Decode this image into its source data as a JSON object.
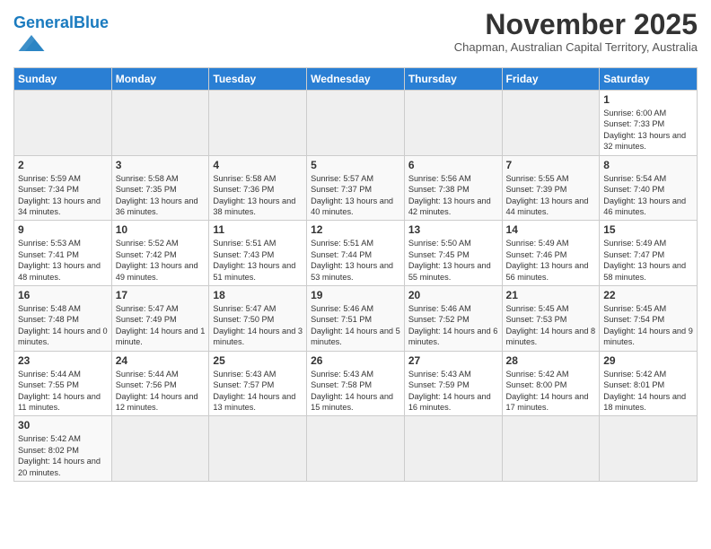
{
  "header": {
    "logo_general": "General",
    "logo_blue": "Blue",
    "month_title": "November 2025",
    "subtitle": "Chapman, Australian Capital Territory, Australia"
  },
  "days_of_week": [
    "Sunday",
    "Monday",
    "Tuesday",
    "Wednesday",
    "Thursday",
    "Friday",
    "Saturday"
  ],
  "weeks": [
    {
      "days": [
        {
          "date": "",
          "empty": true
        },
        {
          "date": "",
          "empty": true
        },
        {
          "date": "",
          "empty": true
        },
        {
          "date": "",
          "empty": true
        },
        {
          "date": "",
          "empty": true
        },
        {
          "date": "",
          "empty": true
        },
        {
          "date": "1",
          "sunrise": "6:00 AM",
          "sunset": "7:33 PM",
          "daylight": "13 hours and 32 minutes."
        }
      ]
    },
    {
      "days": [
        {
          "date": "2",
          "sunrise": "5:59 AM",
          "sunset": "7:34 PM",
          "daylight": "13 hours and 34 minutes."
        },
        {
          "date": "3",
          "sunrise": "5:58 AM",
          "sunset": "7:35 PM",
          "daylight": "13 hours and 36 minutes."
        },
        {
          "date": "4",
          "sunrise": "5:58 AM",
          "sunset": "7:36 PM",
          "daylight": "13 hours and 38 minutes."
        },
        {
          "date": "5",
          "sunrise": "5:57 AM",
          "sunset": "7:37 PM",
          "daylight": "13 hours and 40 minutes."
        },
        {
          "date": "6",
          "sunrise": "5:56 AM",
          "sunset": "7:38 PM",
          "daylight": "13 hours and 42 minutes."
        },
        {
          "date": "7",
          "sunrise": "5:55 AM",
          "sunset": "7:39 PM",
          "daylight": "13 hours and 44 minutes."
        },
        {
          "date": "8",
          "sunrise": "5:54 AM",
          "sunset": "7:40 PM",
          "daylight": "13 hours and 46 minutes."
        }
      ]
    },
    {
      "days": [
        {
          "date": "9",
          "sunrise": "5:53 AM",
          "sunset": "7:41 PM",
          "daylight": "13 hours and 48 minutes."
        },
        {
          "date": "10",
          "sunrise": "5:52 AM",
          "sunset": "7:42 PM",
          "daylight": "13 hours and 49 minutes."
        },
        {
          "date": "11",
          "sunrise": "5:51 AM",
          "sunset": "7:43 PM",
          "daylight": "13 hours and 51 minutes."
        },
        {
          "date": "12",
          "sunrise": "5:51 AM",
          "sunset": "7:44 PM",
          "daylight": "13 hours and 53 minutes."
        },
        {
          "date": "13",
          "sunrise": "5:50 AM",
          "sunset": "7:45 PM",
          "daylight": "13 hours and 55 minutes."
        },
        {
          "date": "14",
          "sunrise": "5:49 AM",
          "sunset": "7:46 PM",
          "daylight": "13 hours and 56 minutes."
        },
        {
          "date": "15",
          "sunrise": "5:49 AM",
          "sunset": "7:47 PM",
          "daylight": "13 hours and 58 minutes."
        }
      ]
    },
    {
      "days": [
        {
          "date": "16",
          "sunrise": "5:48 AM",
          "sunset": "7:48 PM",
          "daylight": "14 hours and 0 minutes."
        },
        {
          "date": "17",
          "sunrise": "5:47 AM",
          "sunset": "7:49 PM",
          "daylight": "14 hours and 1 minute."
        },
        {
          "date": "18",
          "sunrise": "5:47 AM",
          "sunset": "7:50 PM",
          "daylight": "14 hours and 3 minutes."
        },
        {
          "date": "19",
          "sunrise": "5:46 AM",
          "sunset": "7:51 PM",
          "daylight": "14 hours and 5 minutes."
        },
        {
          "date": "20",
          "sunrise": "5:46 AM",
          "sunset": "7:52 PM",
          "daylight": "14 hours and 6 minutes."
        },
        {
          "date": "21",
          "sunrise": "5:45 AM",
          "sunset": "7:53 PM",
          "daylight": "14 hours and 8 minutes."
        },
        {
          "date": "22",
          "sunrise": "5:45 AM",
          "sunset": "7:54 PM",
          "daylight": "14 hours and 9 minutes."
        }
      ]
    },
    {
      "days": [
        {
          "date": "23",
          "sunrise": "5:44 AM",
          "sunset": "7:55 PM",
          "daylight": "14 hours and 11 minutes."
        },
        {
          "date": "24",
          "sunrise": "5:44 AM",
          "sunset": "7:56 PM",
          "daylight": "14 hours and 12 minutes."
        },
        {
          "date": "25",
          "sunrise": "5:43 AM",
          "sunset": "7:57 PM",
          "daylight": "14 hours and 13 minutes."
        },
        {
          "date": "26",
          "sunrise": "5:43 AM",
          "sunset": "7:58 PM",
          "daylight": "14 hours and 15 minutes."
        },
        {
          "date": "27",
          "sunrise": "5:43 AM",
          "sunset": "7:59 PM",
          "daylight": "14 hours and 16 minutes."
        },
        {
          "date": "28",
          "sunrise": "5:42 AM",
          "sunset": "8:00 PM",
          "daylight": "14 hours and 17 minutes."
        },
        {
          "date": "29",
          "sunrise": "5:42 AM",
          "sunset": "8:01 PM",
          "daylight": "14 hours and 18 minutes."
        }
      ]
    },
    {
      "days": [
        {
          "date": "30",
          "sunrise": "5:42 AM",
          "sunset": "8:02 PM",
          "daylight": "14 hours and 20 minutes."
        },
        {
          "date": "",
          "empty": true
        },
        {
          "date": "",
          "empty": true
        },
        {
          "date": "",
          "empty": true
        },
        {
          "date": "",
          "empty": true
        },
        {
          "date": "",
          "empty": true
        },
        {
          "date": "",
          "empty": true
        }
      ]
    }
  ]
}
